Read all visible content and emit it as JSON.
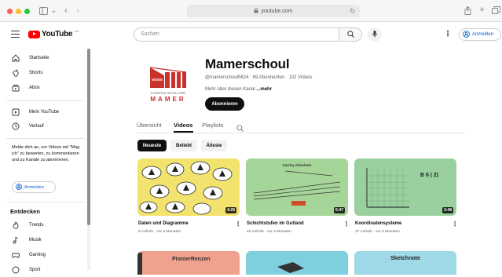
{
  "browser": {
    "url": "youtube.com",
    "colors": {
      "close": "#fe5f57",
      "minimize": "#febc2e",
      "zoom": "#28c840"
    }
  },
  "header": {
    "logo_text": "YouTube",
    "logo_suffix": "LU",
    "search_placeholder": "Suchen",
    "signin_label": "Anmelden",
    "brand_color": "#ff0000"
  },
  "sidebar": {
    "items_top": [
      {
        "label": "Startseite",
        "icon": "home-icon"
      },
      {
        "label": "Shorts",
        "icon": "shorts-icon"
      },
      {
        "label": "Abos",
        "icon": "subscriptions-icon"
      }
    ],
    "items_you": [
      {
        "label": "Mein YouTube",
        "icon": "library-icon"
      },
      {
        "label": "Verlauf",
        "icon": "history-icon"
      }
    ],
    "signin_message": "Melde dich an, um Videos mit \"Mag ich\" zu bewerten, zu kommentieren und zu Kanäle zu abonnieren.",
    "signin_label": "Anmelden",
    "explore_title": "Entdecken",
    "items_explore": [
      {
        "label": "Trends",
        "icon": "trending-icon"
      },
      {
        "label": "Musik",
        "icon": "music-icon"
      },
      {
        "label": "Gaming",
        "icon": "gaming-icon"
      },
      {
        "label": "Sport",
        "icon": "sport-icon"
      }
    ]
  },
  "channel": {
    "name": "Mamerschoul",
    "meta": "@mamerschoul5624 · 69 Abonnenten · 102 Videos",
    "more_prefix": "Mehr über diesen Kanal ",
    "more_link": "...mehr",
    "subscribe_label": "Abonnieren",
    "avatar_text_1": "CAMPUS SCOLAIRE",
    "avatar_text_2": "MAMER",
    "tabs": [
      "Übersicht",
      "Videos",
      "Playlists"
    ],
    "active_tab": "Videos",
    "chips": [
      "Neueste",
      "Beliebt",
      "Älteste"
    ],
    "active_chip": "Neueste"
  },
  "videos": [
    {
      "title": "Daten und Diagramme",
      "meta": "9 Aufrufe · vor 3 Monaten",
      "duration": "4:26",
      "thumb_color": "#f2e36e"
    },
    {
      "title": "Schichtstufen im Gutland",
      "meta": "45 Aufrufe · vor 4 Monaten",
      "duration": "5:47",
      "thumb_color": "#a6d59a",
      "thumb_text": "Sarrley Gleicheln"
    },
    {
      "title": "Koordinatensysteme",
      "meta": "27 Aufrufe · vor 5 Monaten",
      "duration": "3:48",
      "thumb_color": "#9ad0a0",
      "thumb_text": "B 6 | 2)"
    }
  ],
  "videos_row2": [
    {
      "thumb_text": "PionierRenzen",
      "thumb_color": "#f0a28e"
    },
    {
      "thumb_text": "",
      "thumb_color": "#7fd0de"
    },
    {
      "thumb_text": "Sketchnote",
      "thumb_color": "#9fd8e6"
    }
  ]
}
